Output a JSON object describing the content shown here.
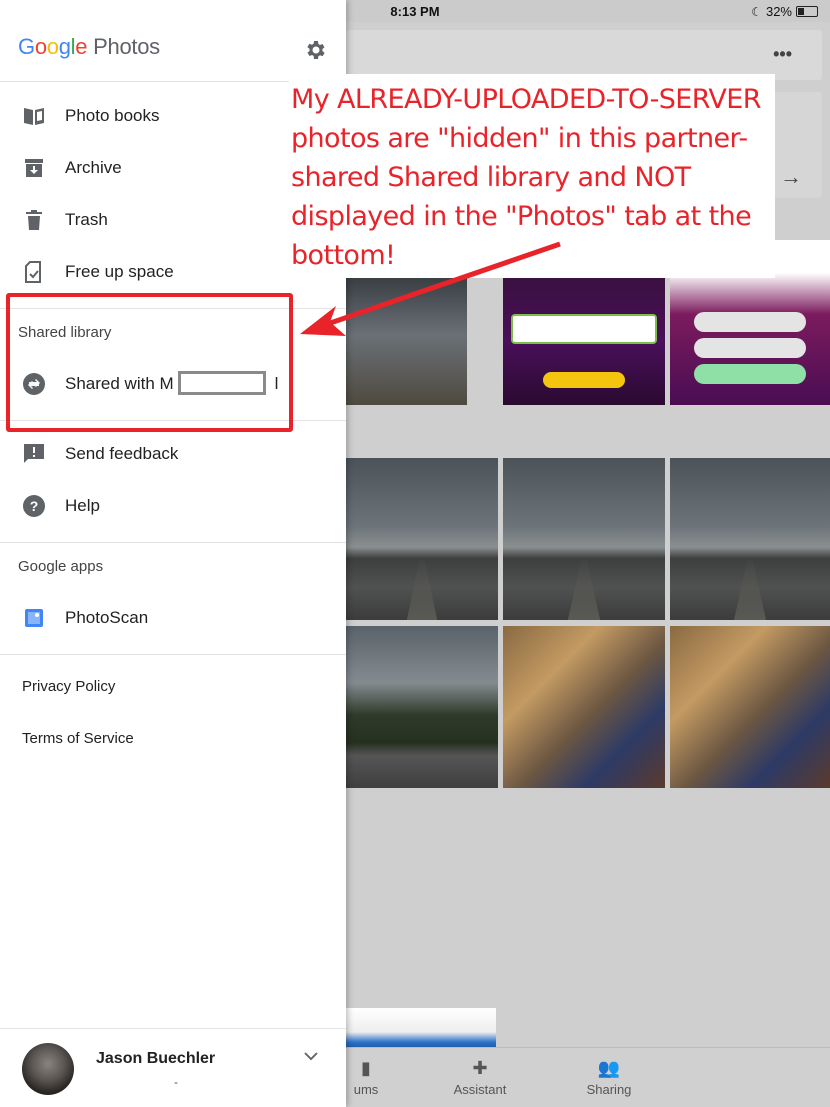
{
  "status_bar": {
    "time": "8:13 PM",
    "battery": "32%"
  },
  "drawer": {
    "logo_google": [
      "G",
      "o",
      "o",
      "g",
      "l",
      "e"
    ],
    "logo_photos": "Photos",
    "menu": [
      {
        "label": "Photo books",
        "icon": "book-icon"
      },
      {
        "label": "Archive",
        "icon": "archive-icon"
      },
      {
        "label": "Trash",
        "icon": "trash-icon"
      },
      {
        "label": "Free up space",
        "icon": "free-up-space-icon"
      }
    ],
    "shared_library": {
      "title": "Shared library",
      "item_prefix": "Shared with M",
      "item_suffix": "l"
    },
    "support": [
      {
        "label": "Send feedback",
        "icon": "feedback-icon"
      },
      {
        "label": "Help",
        "icon": "help-icon"
      }
    ],
    "google_apps": {
      "title": "Google apps",
      "item": "PhotoScan"
    },
    "links": {
      "privacy": "Privacy Policy",
      "terms": "Terms of Service"
    },
    "account": {
      "name": "Jason Buechler",
      "sub": "-"
    }
  },
  "bottom_nav": [
    {
      "label": "ums",
      "icon": "albums-icon"
    },
    {
      "label": "Assistant",
      "icon": "assistant-icon"
    },
    {
      "label": "Sharing",
      "icon": "sharing-icon"
    }
  ],
  "annotation": {
    "lines": [
      "My ALREADY-UPLOADED-TO-SERVER",
      "photos are \"hidden\" in this partner-",
      "shared Shared library and NOT",
      "displayed in the \"Photos\" tab at the",
      "bottom!"
    ],
    "color": "#e8232a"
  }
}
